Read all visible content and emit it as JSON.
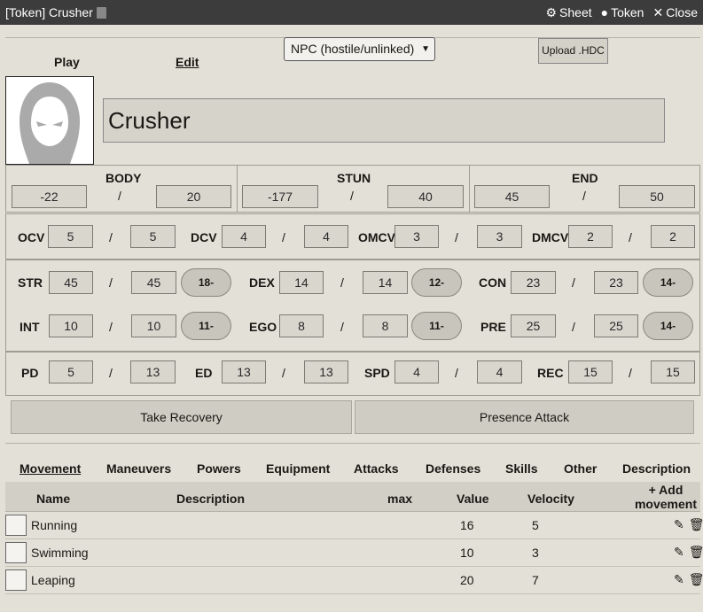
{
  "window": {
    "title": "[Token] Crusher",
    "controls": {
      "sheet": "Sheet",
      "token": "Token",
      "close": "Close"
    }
  },
  "header": {
    "npc_select": "NPC (hostile/unlinked)",
    "upload": "Upload .HDC",
    "play": "Play",
    "edit": "Edit",
    "name": "Crusher"
  },
  "characteristics_top": [
    {
      "label": "BODY",
      "current": "-22",
      "max": "20"
    },
    {
      "label": "STUN",
      "current": "-177",
      "max": "40"
    },
    {
      "label": "END",
      "current": "45",
      "max": "50"
    }
  ],
  "combat": [
    {
      "label": "OCV",
      "current": "5",
      "max": "5"
    },
    {
      "label": "DCV",
      "current": "4",
      "max": "4"
    },
    {
      "label": "OMCV",
      "current": "3",
      "max": "3"
    },
    {
      "label": "DMCV",
      "current": "2",
      "max": "2"
    }
  ],
  "stats_row1": [
    {
      "label": "STR",
      "current": "45",
      "max": "45",
      "roll": "18-"
    },
    {
      "label": "DEX",
      "current": "14",
      "max": "14",
      "roll": "12-"
    },
    {
      "label": "CON",
      "current": "23",
      "max": "23",
      "roll": "14-"
    }
  ],
  "stats_row2": [
    {
      "label": "INT",
      "current": "10",
      "max": "10",
      "roll": "11-"
    },
    {
      "label": "EGO",
      "current": "8",
      "max": "8",
      "roll": "11-"
    },
    {
      "label": "PRE",
      "current": "25",
      "max": "25",
      "roll": "14-"
    }
  ],
  "defense": [
    {
      "label": "PD",
      "current": "5",
      "max": "13"
    },
    {
      "label": "ED",
      "current": "13",
      "max": "13"
    },
    {
      "label": "SPD",
      "current": "4",
      "max": "4"
    },
    {
      "label": "REC",
      "current": "15",
      "max": "15"
    }
  ],
  "buttons": {
    "recovery": "Take Recovery",
    "presence": "Presence Attack"
  },
  "tabs": [
    "Movement",
    "Maneuvers",
    "Powers",
    "Equipment",
    "Attacks",
    "Defenses",
    "Skills",
    "Other",
    "Description"
  ],
  "table": {
    "headers": {
      "name": "Name",
      "description": "Description",
      "max": "max",
      "value": "Value",
      "velocity": "Velocity",
      "add": "Add movement"
    },
    "rows": [
      {
        "name": "Running",
        "value": "16",
        "velocity": "5"
      },
      {
        "name": "Swimming",
        "value": "10",
        "velocity": "3"
      },
      {
        "name": "Leaping",
        "value": "20",
        "velocity": "7"
      }
    ]
  }
}
